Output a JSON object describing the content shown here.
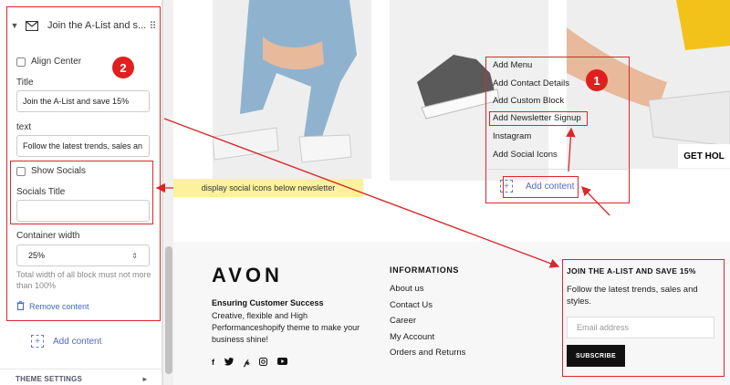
{
  "editor": {
    "block_title": "Join the A-List and s...",
    "align_center_label": "Align Center",
    "title_label": "Title",
    "title_value": "Join the A-List and save 15%",
    "text_label": "text",
    "text_value": "Follow the latest trends, sales an",
    "show_socials_label": "Show Socials",
    "socials_title_label": "Socials Title",
    "socials_title_value": "",
    "container_width_label": "Container width",
    "container_width_value": "25%",
    "hint": "Total width of all block must not more than 100%",
    "remove_label": "Remove content",
    "add_content_label": "Add content",
    "theme_settings_label": "THEME SETTINGS"
  },
  "annotations": {
    "badge_1": "1",
    "badge_2": "2",
    "tooltip": "display social icons below newsletter"
  },
  "add_menu": {
    "items": [
      "Add Menu",
      "Add Contact Details",
      "Add Custom Block",
      "Add Newsletter Signup",
      "Instagram",
      "Add Social Icons"
    ],
    "add_content_label": "Add content"
  },
  "preview": {
    "get_hold_label": "GET HOL"
  },
  "footer": {
    "brand": "AVON",
    "tagline": "Ensuring Customer Success",
    "description": "Creative, flexible and High Performanceshopify theme to make your business shine!",
    "socials": [
      "f",
      "t",
      "p",
      "ig",
      "yt"
    ],
    "informations_title": "INFORMATIONS",
    "informations_links": [
      "About us",
      "Contact Us",
      "Career",
      "My Account",
      "Orders and Returns"
    ],
    "newsletter_title": "JOIN THE A-LIST AND SAVE 15%",
    "newsletter_text": "Follow the latest trends, sales and styles.",
    "email_placeholder": "Email address",
    "subscribe_label": "SUBSCRIBE"
  },
  "colors": {
    "annotation_red": "#d9282a",
    "accent_blue": "#5566c8",
    "tooltip_yellow": "#fdf29c"
  }
}
